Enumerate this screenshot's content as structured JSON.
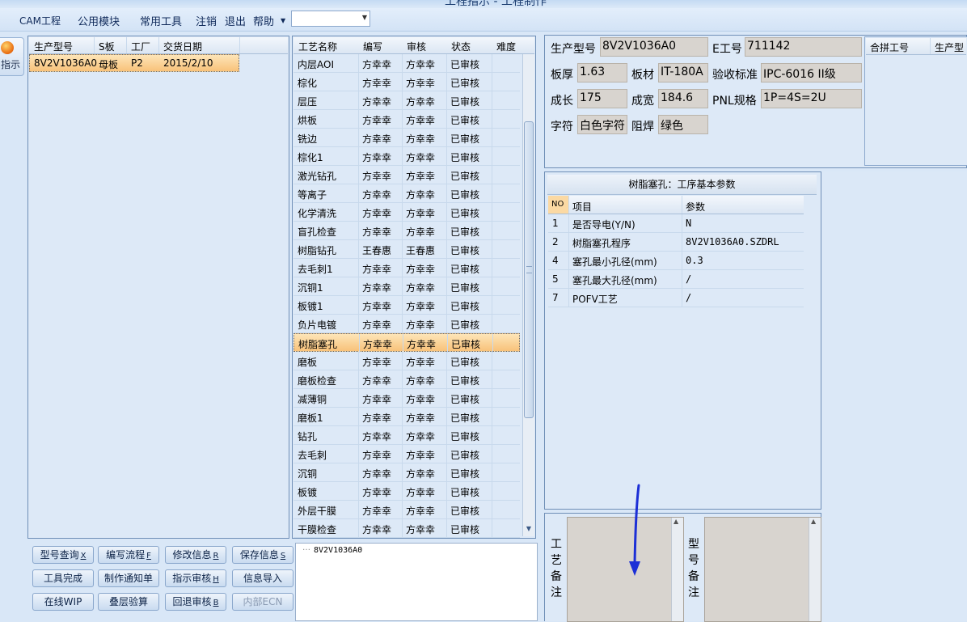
{
  "title_fragment": "工程指示 - 工程制作",
  "menu": {
    "items": [
      "CAM工程",
      "公用模块",
      "常用工具",
      "注销",
      "退出",
      "帮助"
    ],
    "dropdown_value": ""
  },
  "side_button": {
    "label": "指示"
  },
  "orders": {
    "headers": [
      "生产型号",
      "S板",
      "工厂",
      "交货日期"
    ],
    "rows": [
      {
        "model": "8V2V1036A0",
        "board": "母板",
        "plant": "P2",
        "date": "2015/2/10"
      }
    ]
  },
  "process": {
    "headers": [
      "工艺名称",
      "编写",
      "审核",
      "状态",
      "难度"
    ],
    "rows": [
      [
        "内层AOI",
        "方幸幸",
        "方幸幸",
        "已审核",
        ""
      ],
      [
        "棕化",
        "方幸幸",
        "方幸幸",
        "已审核",
        ""
      ],
      [
        "层压",
        "方幸幸",
        "方幸幸",
        "已审核",
        ""
      ],
      [
        "烘板",
        "方幸幸",
        "方幸幸",
        "已审核",
        ""
      ],
      [
        "铣边",
        "方幸幸",
        "方幸幸",
        "已审核",
        ""
      ],
      [
        "棕化1",
        "方幸幸",
        "方幸幸",
        "已审核",
        ""
      ],
      [
        "激光钻孔",
        "方幸幸",
        "方幸幸",
        "已审核",
        ""
      ],
      [
        "等离子",
        "方幸幸",
        "方幸幸",
        "已审核",
        ""
      ],
      [
        "化学清洗",
        "方幸幸",
        "方幸幸",
        "已审核",
        ""
      ],
      [
        "盲孔检查",
        "方幸幸",
        "方幸幸",
        "已审核",
        ""
      ],
      [
        "树脂钻孔",
        "王春惠",
        "王春惠",
        "已审核",
        ""
      ],
      [
        "去毛刺1",
        "方幸幸",
        "方幸幸",
        "已审核",
        ""
      ],
      [
        "沉铜1",
        "方幸幸",
        "方幸幸",
        "已审核",
        ""
      ],
      [
        "板镀1",
        "方幸幸",
        "方幸幸",
        "已审核",
        ""
      ],
      [
        "负片电镀",
        "方幸幸",
        "方幸幸",
        "已审核",
        ""
      ],
      [
        "树脂塞孔",
        "方幸幸",
        "方幸幸",
        "已审核",
        ""
      ],
      [
        "磨板",
        "方幸幸",
        "方幸幸",
        "已审核",
        ""
      ],
      [
        "磨板检查",
        "方幸幸",
        "方幸幸",
        "已审核",
        ""
      ],
      [
        "减薄铜",
        "方幸幸",
        "方幸幸",
        "已审核",
        ""
      ],
      [
        "磨板1",
        "方幸幸",
        "方幸幸",
        "已审核",
        ""
      ],
      [
        "钻孔",
        "方幸幸",
        "方幸幸",
        "已审核",
        ""
      ],
      [
        "去毛刺",
        "方幸幸",
        "方幸幸",
        "已审核",
        ""
      ],
      [
        "沉铜",
        "方幸幸",
        "方幸幸",
        "已审核",
        ""
      ],
      [
        "板镀",
        "方幸幸",
        "方幸幸",
        "已审核",
        ""
      ],
      [
        "外层干膜",
        "方幸幸",
        "方幸幸",
        "已审核",
        ""
      ],
      [
        "干膜检查",
        "方幸幸",
        "方幸幸",
        "已审核",
        ""
      ]
    ],
    "selected_index": 15
  },
  "buttons": [
    {
      "label": "型号查询",
      "key": "X",
      "enabled": true
    },
    {
      "label": "编写流程",
      "key": "F",
      "enabled": true
    },
    {
      "label": "修改信息",
      "key": "R",
      "enabled": true
    },
    {
      "label": "保存信息",
      "key": "S",
      "enabled": true
    },
    {
      "label": "工具完成",
      "key": "",
      "enabled": true
    },
    {
      "label": "制作通知单",
      "key": "",
      "enabled": true
    },
    {
      "label": "指示审核",
      "key": "H",
      "enabled": true
    },
    {
      "label": "信息导入",
      "key": "",
      "enabled": true
    },
    {
      "label": "在线WIP",
      "key": "",
      "enabled": true
    },
    {
      "label": "叠层验算",
      "key": "",
      "enabled": true
    },
    {
      "label": "回退审核",
      "key": "B",
      "enabled": true
    },
    {
      "label": "内部ECN",
      "key": "",
      "enabled": false
    }
  ],
  "tree": {
    "node": "8V2V1036A0"
  },
  "info": {
    "model_label": "生产型号",
    "model_value": "8V2V1036A0",
    "e_label": "E工号",
    "e_value": "711142",
    "thickness_label": "板厚",
    "thickness_value": "1.63",
    "material_label": "板材",
    "material_value": "IT-180A",
    "standard_label": "验收标准",
    "standard_value": "IPC-6016 II级",
    "length_label": "成长",
    "length_value": "175",
    "width_label": "成宽",
    "width_value": "184.6",
    "pnl_label": "PNL规格",
    "pnl_value": "1P=4S=2U",
    "silk_label": "字符",
    "silk_value": "白色字符",
    "mask_label": "阻焊",
    "mask_value": "绿色"
  },
  "merge": {
    "headers": [
      "合拼工号",
      "生产型"
    ]
  },
  "params": {
    "title": "树脂塞孔：工序基本参数",
    "headers": [
      "NO",
      "项目",
      "参数"
    ],
    "rows": [
      [
        "1",
        "是否导电(Y/N)",
        "N"
      ],
      [
        "2",
        "树脂塞孔程序",
        "8V2V1036A0.SZDRL"
      ],
      [
        "4",
        "塞孔最小孔径(mm)",
        "0.3"
      ],
      [
        "5",
        "塞孔最大孔径(mm)",
        "/"
      ],
      [
        "7",
        "POFV工艺",
        "/"
      ]
    ]
  },
  "notes": {
    "process_label": [
      "工",
      "艺",
      "备",
      "注"
    ],
    "model_label": [
      "型",
      "号",
      "备",
      "注"
    ]
  },
  "colors": {
    "selection": "#f8c27a",
    "annotation_arrow": "#1c2fd6"
  }
}
